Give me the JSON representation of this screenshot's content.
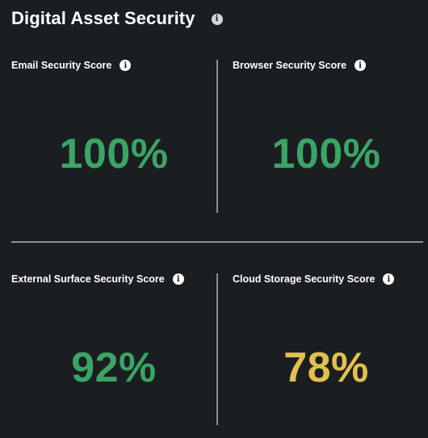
{
  "header": {
    "title": "Digital Asset Security",
    "info_icon": "info-icon"
  },
  "cards": [
    {
      "label": "Email Security Score",
      "value": "100%",
      "color": "#3aa565",
      "info_icon": "info-icon"
    },
    {
      "label": "Browser Security Score",
      "value": "100%",
      "color": "#3aa565",
      "info_icon": "info-icon"
    },
    {
      "label": "External Surface Security Score",
      "value": "92%",
      "color": "#3aa565",
      "info_icon": "info-icon"
    },
    {
      "label": "Cloud Storage Security Score",
      "value": "78%",
      "color": "#e2c04f",
      "info_icon": "info-icon"
    }
  ],
  "colors": {
    "background": "#1b1e21",
    "good": "#3aa565",
    "warning": "#e2c04f",
    "divider": "#8a8f94"
  }
}
